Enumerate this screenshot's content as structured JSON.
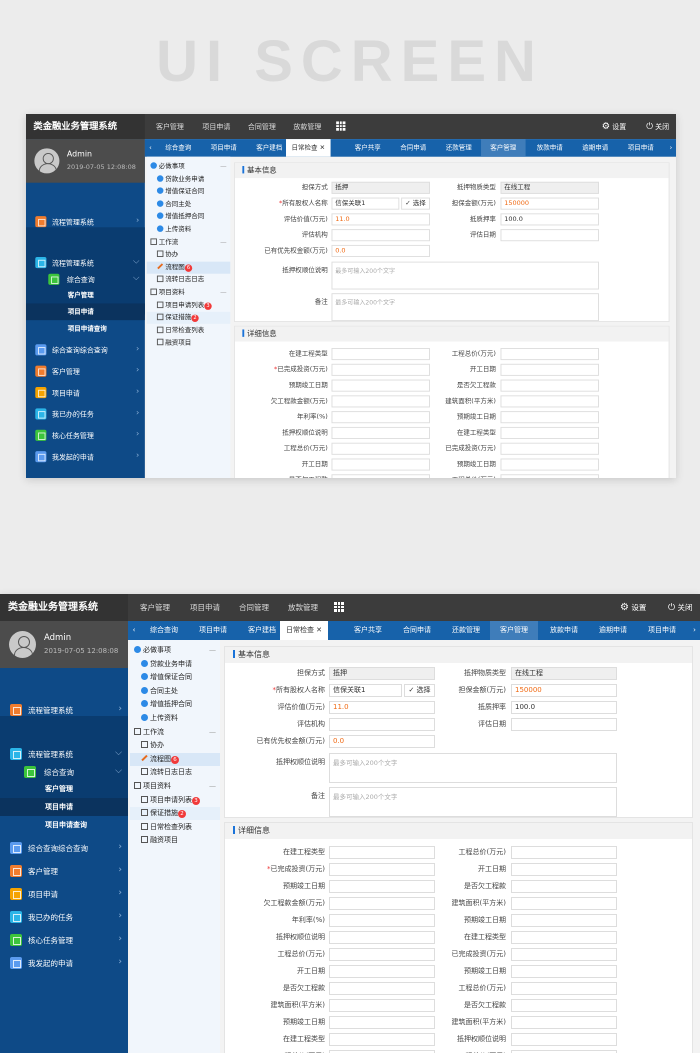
{
  "hero_title": "UI SCREEN",
  "header": {
    "title": "类金融业务管理系统",
    "nav": [
      "客户管理",
      "项目申请",
      "合同管理",
      "放款管理"
    ],
    "apps_icon": "grid-icon",
    "settings_label": "设置",
    "close_label": "关闭"
  },
  "user": {
    "name": "Admin",
    "datetime": "2019-07-05 12:08:08"
  },
  "sidebar": {
    "items_top": [
      {
        "label": "流程管理系统",
        "color": "#f07c2e"
      },
      {
        "label": "核心任务管理",
        "color": "#f5a623"
      }
    ],
    "expanded": {
      "label": "流程管理系统",
      "color": "#2bb5e8",
      "child": {
        "label": "综合查询",
        "color": "#3cc43c"
      },
      "subs": [
        "客户管理",
        "项目申请",
        "项目申请查询"
      ],
      "active_sub": 1
    },
    "items_bottom": [
      {
        "label": "综合查询综合查询",
        "color": "#5b9bef"
      },
      {
        "label": "客户管理",
        "color": "#f07c2e"
      },
      {
        "label": "项目申请",
        "color": "#f5a300"
      },
      {
        "label": "我已办的任务",
        "color": "#2bb5e8"
      },
      {
        "label": "核心任务管理",
        "color": "#3cc43c"
      },
      {
        "label": "我发起的申请",
        "color": "#5b9bef"
      }
    ]
  },
  "tabs": [
    "综合查询",
    "项目申请",
    "客户建档",
    "日常检查",
    "客户共享",
    "合同申请",
    "还款管理",
    "客户管理",
    "放款申请",
    "逾期申请",
    "项目申请"
  ],
  "active_tab": 3,
  "tree": [
    {
      "label": "必做事项",
      "type": "group-check"
    },
    {
      "label": "贷款业务申请",
      "type": "check"
    },
    {
      "label": "增值保证合同",
      "type": "check"
    },
    {
      "label": "合同主处",
      "type": "check"
    },
    {
      "label": "增值抵押合同",
      "type": "check"
    },
    {
      "label": "上传资料",
      "type": "check"
    },
    {
      "label": "工作流",
      "type": "group-edit"
    },
    {
      "label": "协办",
      "type": "edit"
    },
    {
      "label": "流程图",
      "type": "pen",
      "badge": "6",
      "highlight": true
    },
    {
      "label": "流转日志日志",
      "type": "edit"
    },
    {
      "label": "项目资料",
      "type": "group-edit"
    },
    {
      "label": "项目申请列表",
      "type": "edit",
      "badge": "3"
    },
    {
      "label": "保证措施",
      "type": "edit",
      "badge": "2",
      "highlight2": true
    },
    {
      "label": "日常检查列表",
      "type": "edit"
    },
    {
      "label": "融资项目",
      "type": "edit"
    }
  ],
  "basic": {
    "title": "基本信息",
    "rows": [
      {
        "left": {
          "label": "担保方式",
          "value": "抵押",
          "style": "ro"
        },
        "right": {
          "label": "抵押物质类型",
          "value": "在线工程",
          "style": "ro"
        }
      },
      {
        "left": {
          "label": "所有股权人名称",
          "required": true,
          "value": "信保关联1",
          "button": "✓ 选择"
        },
        "right": {
          "label": "担保金额(万元)",
          "value": "150000",
          "style": "or"
        }
      },
      {
        "left": {
          "label": "评估价值(万元)",
          "value": "11.0",
          "style": "or"
        },
        "right": {
          "label": "抵质押率",
          "value": "100.0"
        }
      },
      {
        "left": {
          "label": "评估机构",
          "value": ""
        },
        "right": {
          "label": "评估日期",
          "value": ""
        }
      },
      {
        "left": {
          "label": "已有优先权金额(万元)",
          "value": "0.0",
          "style": "or"
        }
      }
    ],
    "textareas": [
      {
        "label": "抵押权顺位说明",
        "placeholder": "最多可输入200个文字"
      },
      {
        "label": "备注",
        "placeholder": "最多可输入200个文字"
      }
    ]
  },
  "detail": {
    "title": "详细信息",
    "left": [
      "在建工程类型",
      "已完成投资(万元)",
      "预期竣工日期",
      "欠工程款金额(万元)",
      "年利率(%)",
      "抵押权顺位说明",
      "工程总价(万元)",
      "开工日期",
      "是否欠工程款",
      "建筑面积(平方米)",
      "预期竣工日期",
      "在建工程类型",
      "工程总价(万元)"
    ],
    "left_required_index": 1,
    "right": [
      "工程总价(万元)",
      "开工日期",
      "是否欠工程款",
      "建筑面积(平方米)",
      "预期竣工日期",
      "在建工程类型",
      "已完成投资(万元)",
      "预期竣工日期",
      "工程总价(万元)",
      "是否欠工程款",
      "建筑面积(平方米)",
      "抵押权顺位说明",
      "工程总价(万元)"
    ]
  }
}
